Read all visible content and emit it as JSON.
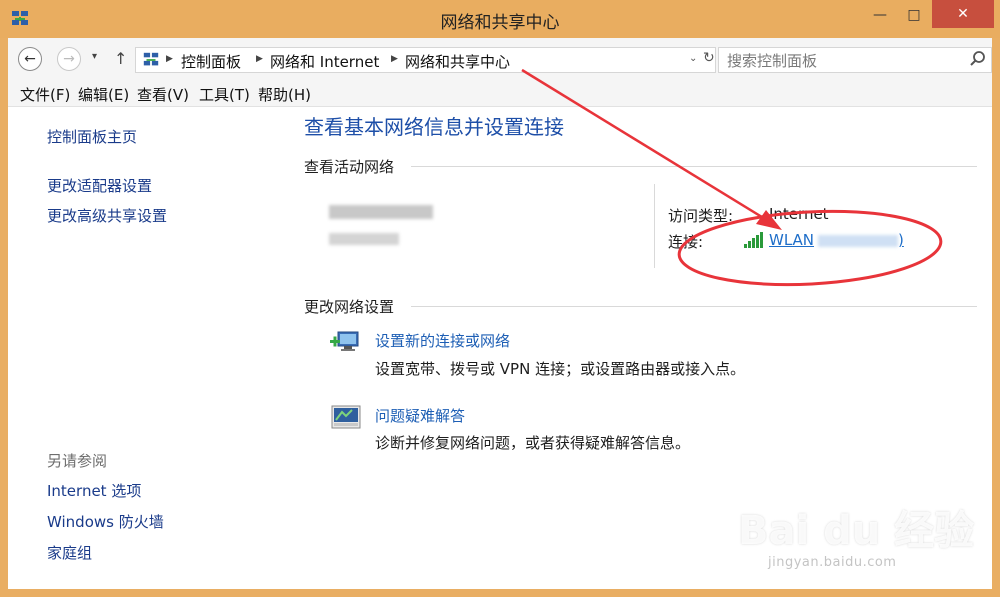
{
  "window": {
    "title": "网络和共享中心",
    "controls": {
      "minimize": "—",
      "maximize": "□",
      "close": "✕"
    }
  },
  "nav": {
    "back": "←",
    "forward": "→",
    "recent": "▾",
    "up": "↑",
    "breadcrumb": [
      "控制面板",
      "网络和 Internet",
      "网络和共享中心"
    ],
    "separator": "▶",
    "dropdown": "⌄",
    "refresh": "↻"
  },
  "search": {
    "placeholder": "搜索控制面板"
  },
  "menu": [
    "文件(F)",
    "编辑(E)",
    "查看(V)",
    "工具(T)",
    "帮助(H)"
  ],
  "sidebar": {
    "home": "控制面板主页",
    "links": [
      "更改适配器设置",
      "更改高级共享设置"
    ],
    "see_also_heading": "另请参阅",
    "see_also": [
      "Internet 选项",
      "Windows 防火墙",
      "家庭组"
    ]
  },
  "main": {
    "title": "查看基本网络信息并设置连接",
    "active_heading": "查看活动网络",
    "access_type_label": "访问类型:",
    "access_type_value": "Internet",
    "connection_label": "连接:",
    "connection_value": "WLAN",
    "connection_suffix": ")",
    "change_heading": "更改网络设置",
    "tasks": [
      {
        "link": "设置新的连接或网络",
        "desc": "设置宽带、拨号或 VPN 连接；或设置路由器或接入点。"
      },
      {
        "link": "问题疑难解答",
        "desc": "诊断并修复网络问题，或者获得疑难解答信息。"
      }
    ]
  },
  "watermark": {
    "logo": "Bai du 经验",
    "url": "jingyan.baidu.com"
  },
  "colors": {
    "frame": "#e9ad60",
    "close": "#c74f3e",
    "link": "#1e4fa8",
    "annotation": "#e8343a"
  }
}
